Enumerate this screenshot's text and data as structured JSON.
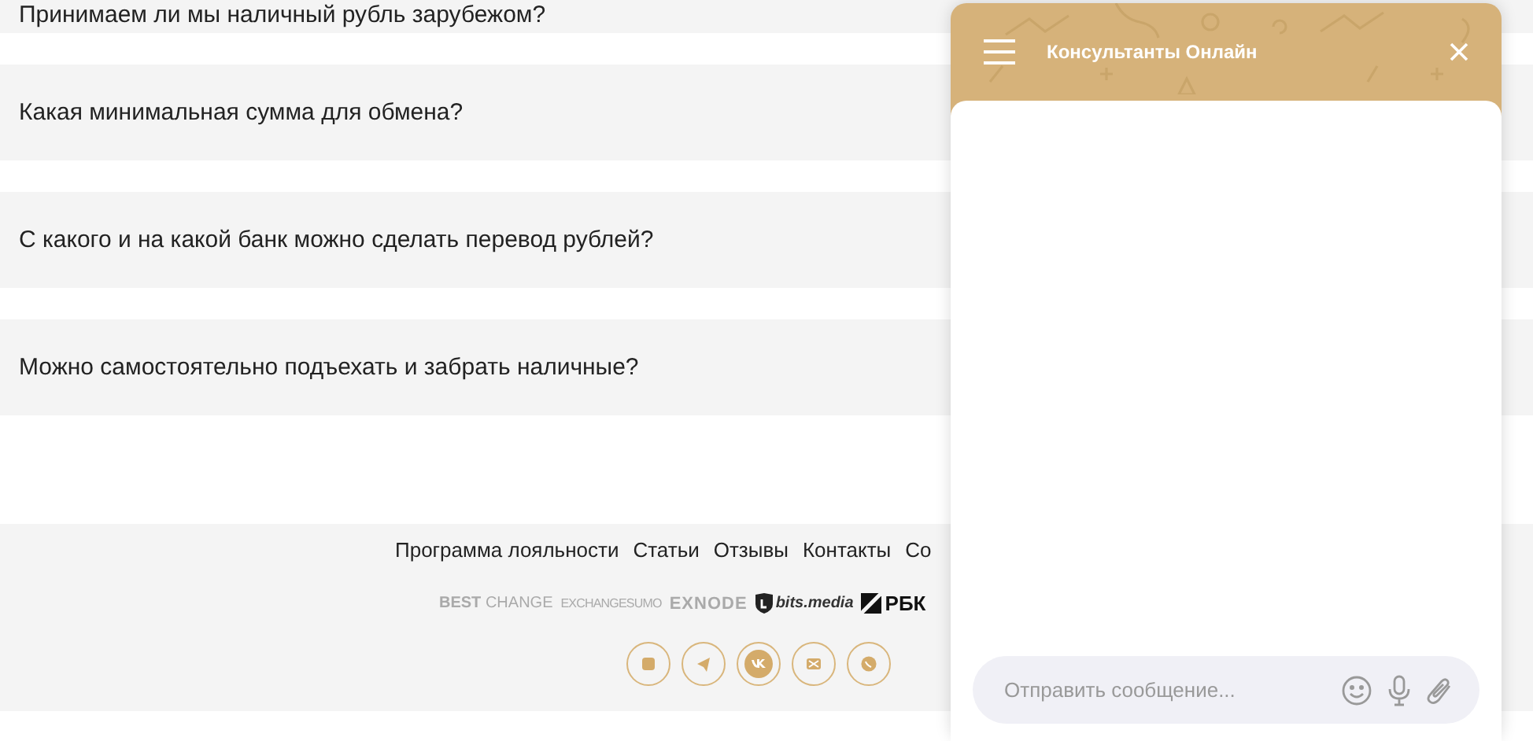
{
  "faq": [
    {
      "question": "Принимаем ли мы наличный рубль зарубежом?"
    },
    {
      "question": "Какая минимальная сумма для обмена?"
    },
    {
      "question": "С какого и на какой банк можно сделать перевод рублей?"
    },
    {
      "question": "Можно самостоятельно подъехать и забрать наличные?"
    }
  ],
  "footer": {
    "links": [
      "Программа лояльности",
      "Статьи",
      "Отзывы",
      "Контакты",
      "Со"
    ],
    "partners": [
      {
        "kind": "split",
        "text": "**BEST** CHANGE"
      },
      {
        "kind": "condensed",
        "text": "EXCHANGESUMO"
      },
      {
        "kind": "wide",
        "text": "EXNODE"
      },
      {
        "kind": "shield",
        "text": "bits.media"
      },
      {
        "kind": "slash",
        "text": "РБК"
      }
    ],
    "social": [
      {
        "kind": "square"
      },
      {
        "kind": "plane"
      },
      {
        "kind": "vk"
      },
      {
        "kind": "mail"
      },
      {
        "kind": "phone"
      }
    ]
  },
  "chat": {
    "title": "Консультанты Онлайн",
    "input": {
      "placeholder": "Отправить сообщение..."
    }
  }
}
